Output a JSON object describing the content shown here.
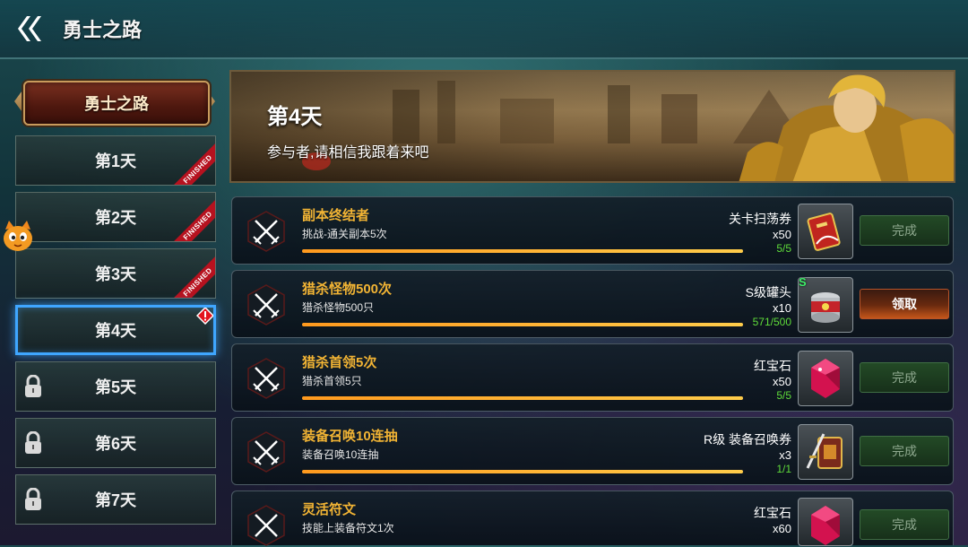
{
  "header": {
    "title": "勇士之路"
  },
  "sidebar": {
    "banner_label": "勇士之路",
    "days": [
      {
        "label": "第1天",
        "status": "finished",
        "badge": "FINISHED"
      },
      {
        "label": "第2天",
        "status": "finished",
        "badge": "FINISHED"
      },
      {
        "label": "第3天",
        "status": "finished",
        "badge": "FINISHED"
      },
      {
        "label": "第4天",
        "status": "active"
      },
      {
        "label": "第5天",
        "status": "locked"
      },
      {
        "label": "第6天",
        "status": "locked"
      },
      {
        "label": "第7天",
        "status": "locked"
      }
    ]
  },
  "hero": {
    "title": "第4天",
    "subtitle": "参与者,请相信我跟着来吧"
  },
  "quests": [
    {
      "title": "副本终结者",
      "desc": "挑战-通关副本5次",
      "progress_text": "5/5",
      "progress": 1.0,
      "reward_name": "关卡扫荡券",
      "reward_qty": "x50",
      "reward_icon": "sweep-ticket-icon",
      "button": "完成",
      "button_state": "done"
    },
    {
      "title": "猎杀怪物500次",
      "desc": "猎杀怪物500只",
      "progress_text": "571/500",
      "progress": 1.0,
      "reward_name": "S级罐头",
      "reward_qty": "x10",
      "reward_icon": "canned-food-icon",
      "reward_badge": "S",
      "button": "领取",
      "button_state": "claim"
    },
    {
      "title": "猎杀首领5次",
      "desc": "猎杀首领5只",
      "progress_text": "5/5",
      "progress": 1.0,
      "reward_name": "红宝石",
      "reward_qty": "x50",
      "reward_icon": "ruby-icon",
      "button": "完成",
      "button_state": "done"
    },
    {
      "title": "装备召唤10连抽",
      "desc": "装备召唤10连抽",
      "progress_text": "1/1",
      "progress": 1.0,
      "reward_name": "R级 装备召唤券",
      "reward_qty": "x3",
      "reward_icon": "equipment-ticket-icon",
      "button": "完成",
      "button_state": "done"
    },
    {
      "title": "灵活符文",
      "desc": "技能上装备符文1次",
      "progress_text": "",
      "progress": 1.0,
      "reward_name": "红宝石",
      "reward_qty": "x60",
      "reward_icon": "ruby-icon",
      "button": "完成",
      "button_state": "done"
    }
  ],
  "colors": {
    "quest_title": "#f2b434",
    "progress_ok": "#5fdc3a",
    "active_border": "#3fa6ff",
    "finished_ribbon": "#b6121f"
  }
}
